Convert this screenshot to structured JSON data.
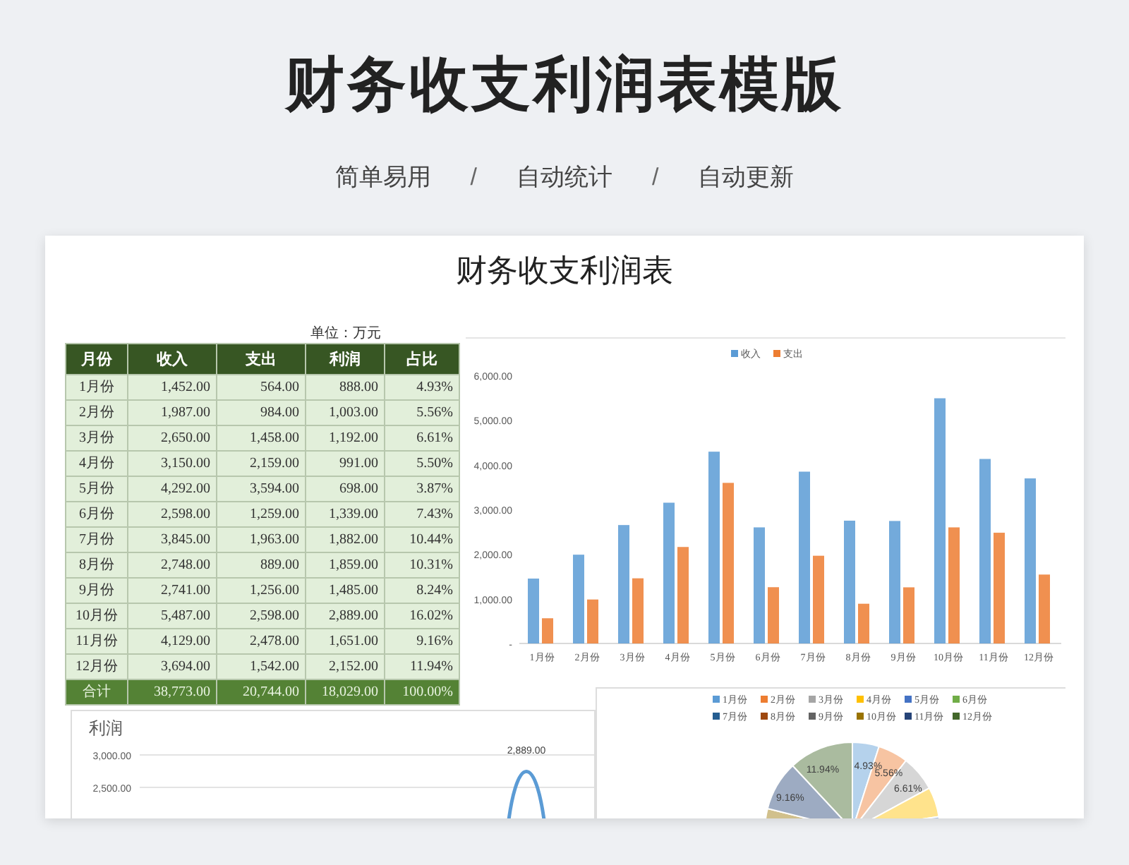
{
  "header": {
    "title": "财务收支利润表模版",
    "features": [
      "简单易用",
      "自动统计",
      "自动更新"
    ],
    "separator": "/"
  },
  "sheet": {
    "title": "财务收支利润表",
    "unit": "单位：万元",
    "table": {
      "columns": [
        "月份",
        "收入",
        "支出",
        "利润",
        "占比"
      ],
      "rows": [
        [
          "1月份",
          "1,452.00",
          "564.00",
          "888.00",
          "4.93%"
        ],
        [
          "2月份",
          "1,987.00",
          "984.00",
          "1,003.00",
          "5.56%"
        ],
        [
          "3月份",
          "2,650.00",
          "1,458.00",
          "1,192.00",
          "6.61%"
        ],
        [
          "4月份",
          "3,150.00",
          "2,159.00",
          "991.00",
          "5.50%"
        ],
        [
          "5月份",
          "4,292.00",
          "3,594.00",
          "698.00",
          "3.87%"
        ],
        [
          "6月份",
          "2,598.00",
          "1,259.00",
          "1,339.00",
          "7.43%"
        ],
        [
          "7月份",
          "3,845.00",
          "1,963.00",
          "1,882.00",
          "10.44%"
        ],
        [
          "8月份",
          "2,748.00",
          "889.00",
          "1,859.00",
          "10.31%"
        ],
        [
          "9月份",
          "2,741.00",
          "1,256.00",
          "1,485.00",
          "8.24%"
        ],
        [
          "10月份",
          "5,487.00",
          "2,598.00",
          "2,889.00",
          "16.02%"
        ],
        [
          "11月份",
          "4,129.00",
          "2,478.00",
          "1,651.00",
          "9.16%"
        ],
        [
          "12月份",
          "3,694.00",
          "1,542.00",
          "2,152.00",
          "11.94%"
        ]
      ],
      "total": [
        "合计",
        "38,773.00",
        "20,744.00",
        "18,029.00",
        "100.00%"
      ]
    },
    "bar_chart": {
      "chart_data": {
        "type": "bar",
        "categories": [
          "1月份",
          "2月份",
          "3月份",
          "4月份",
          "5月份",
          "6月份",
          "7月份",
          "8月份",
          "9月份",
          "10月份",
          "11月份",
          "12月份"
        ],
        "series": [
          {
            "name": "收入",
            "color": "#5b9bd5",
            "values": [
              1452,
              1987,
              2650,
              3150,
              4292,
              2598,
              3845,
              2748,
              2741,
              5487,
              4129,
              3694
            ]
          },
          {
            "name": "支出",
            "color": "#ed7d31",
            "values": [
              564,
              984,
              1458,
              2159,
              3594,
              1259,
              1963,
              889,
              1256,
              2598,
              2478,
              1542
            ]
          }
        ],
        "ylim": [
          0,
          6000
        ],
        "legend": true,
        "yticks": [
          {
            "value": 0,
            "label": "-"
          },
          {
            "value": 1000,
            "label": "1,000.00"
          },
          {
            "value": 2000,
            "label": "2,000.00"
          },
          {
            "value": 3000,
            "label": "3,000.00"
          },
          {
            "value": 4000,
            "label": "4,000.00"
          },
          {
            "value": 5000,
            "label": "5,000.00"
          },
          {
            "value": 6000,
            "label": "6,000.00"
          }
        ]
      }
    },
    "line_chart": {
      "title": "利润",
      "y_labels": [
        "3,000.00",
        "2,500.00"
      ],
      "peak_label": "2,889.00"
    },
    "pie_chart": {
      "legend": [
        {
          "label": "1月份",
          "color": "#5b9bd5",
          "slice_label": "4.93%"
        },
        {
          "label": "2月份",
          "color": "#ed7d31",
          "slice_label": "5.56%"
        },
        {
          "label": "3月份",
          "color": "#a5a5a5",
          "slice_label": "6.61%"
        },
        {
          "label": "4月份",
          "color": "#ffc000"
        },
        {
          "label": "5月份",
          "color": "#4472c4"
        },
        {
          "label": "6月份",
          "color": "#70ad47"
        },
        {
          "label": "7月份",
          "color": "#255e91"
        },
        {
          "label": "8月份",
          "color": "#9e480e"
        },
        {
          "label": "9月份",
          "color": "#636363"
        },
        {
          "label": "10月份",
          "color": "#997300"
        },
        {
          "label": "11月份",
          "color": "#264478",
          "slice_label": "9.16%"
        },
        {
          "label": "12月份",
          "color": "#43682b",
          "slice_label": "11.94%"
        }
      ]
    }
  }
}
